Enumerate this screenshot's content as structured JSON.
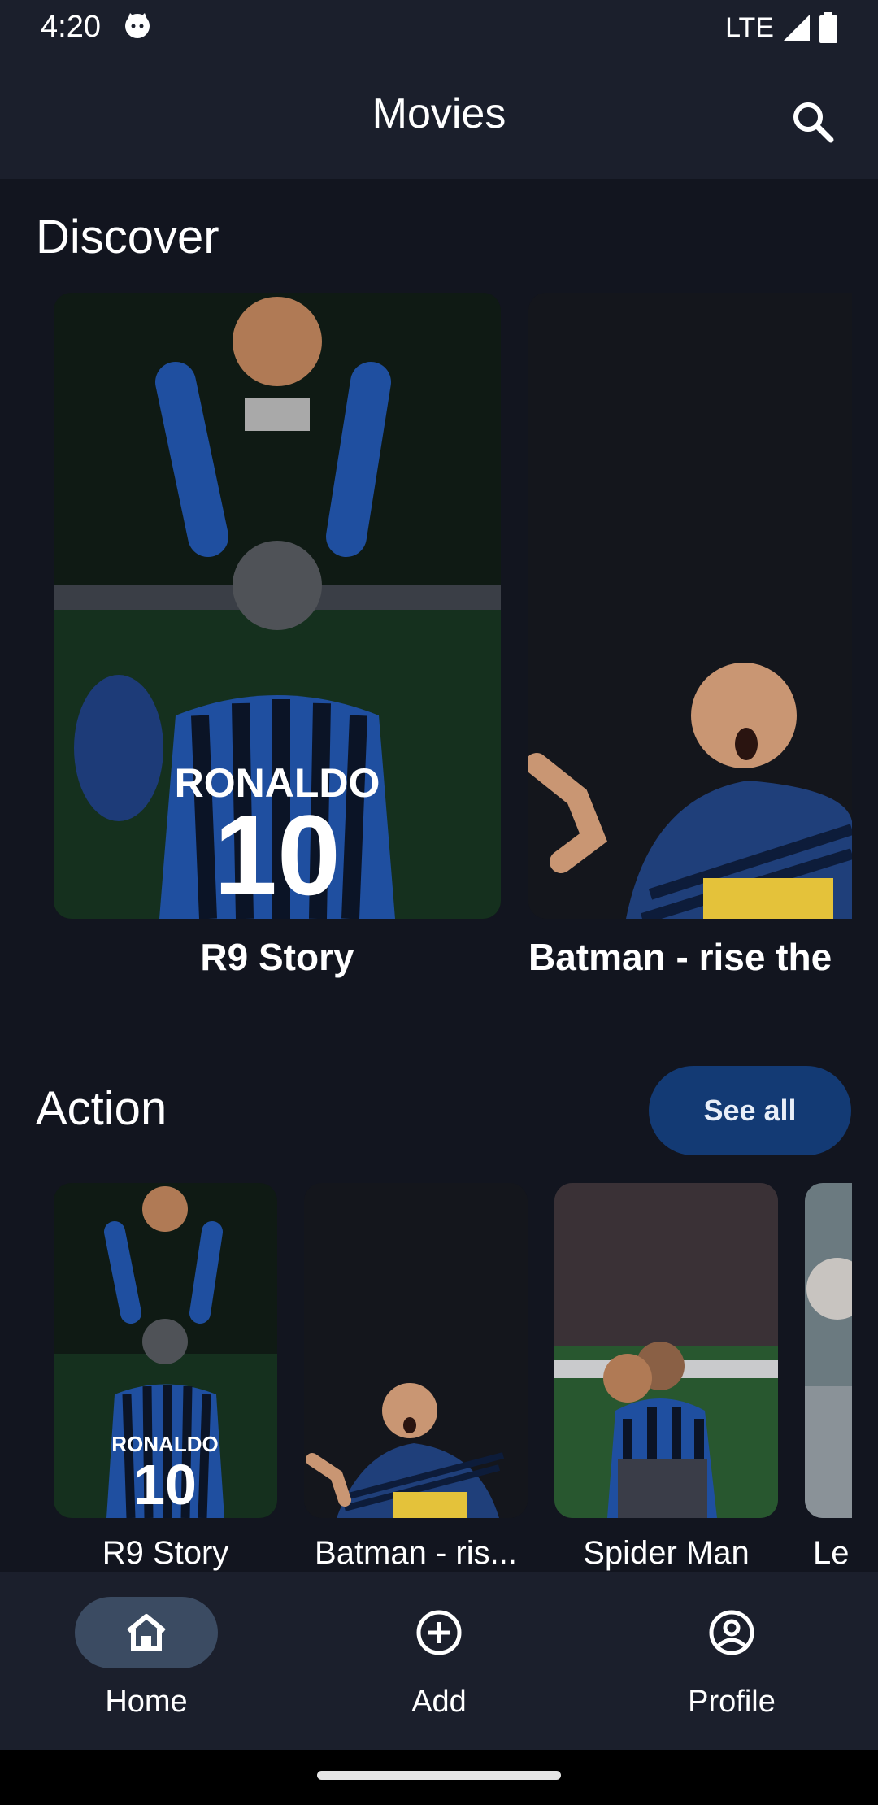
{
  "status": {
    "time": "4:20",
    "network": "LTE"
  },
  "header": {
    "title": "Movies",
    "search_icon": "search-icon"
  },
  "discover": {
    "title": "Discover",
    "items": [
      {
        "title": "R9 Story"
      },
      {
        "title": "Batman - rise the"
      }
    ]
  },
  "action": {
    "title": "Action",
    "see_all": "See all",
    "items": [
      {
        "title": "R9 Story"
      },
      {
        "title": "Batman - ris..."
      },
      {
        "title": "Spider Man"
      },
      {
        "title": "Le"
      }
    ]
  },
  "nav": {
    "items": [
      {
        "label": "Home",
        "icon": "home-icon",
        "selected": true
      },
      {
        "label": "Add",
        "icon": "add-circle-icon",
        "selected": false
      },
      {
        "label": "Profile",
        "icon": "profile-icon",
        "selected": false
      }
    ]
  },
  "colors": {
    "background": "#12151f",
    "surface": "#1b1f2c",
    "accent_button": "#133a74",
    "nav_pill": "#3b4b62"
  }
}
